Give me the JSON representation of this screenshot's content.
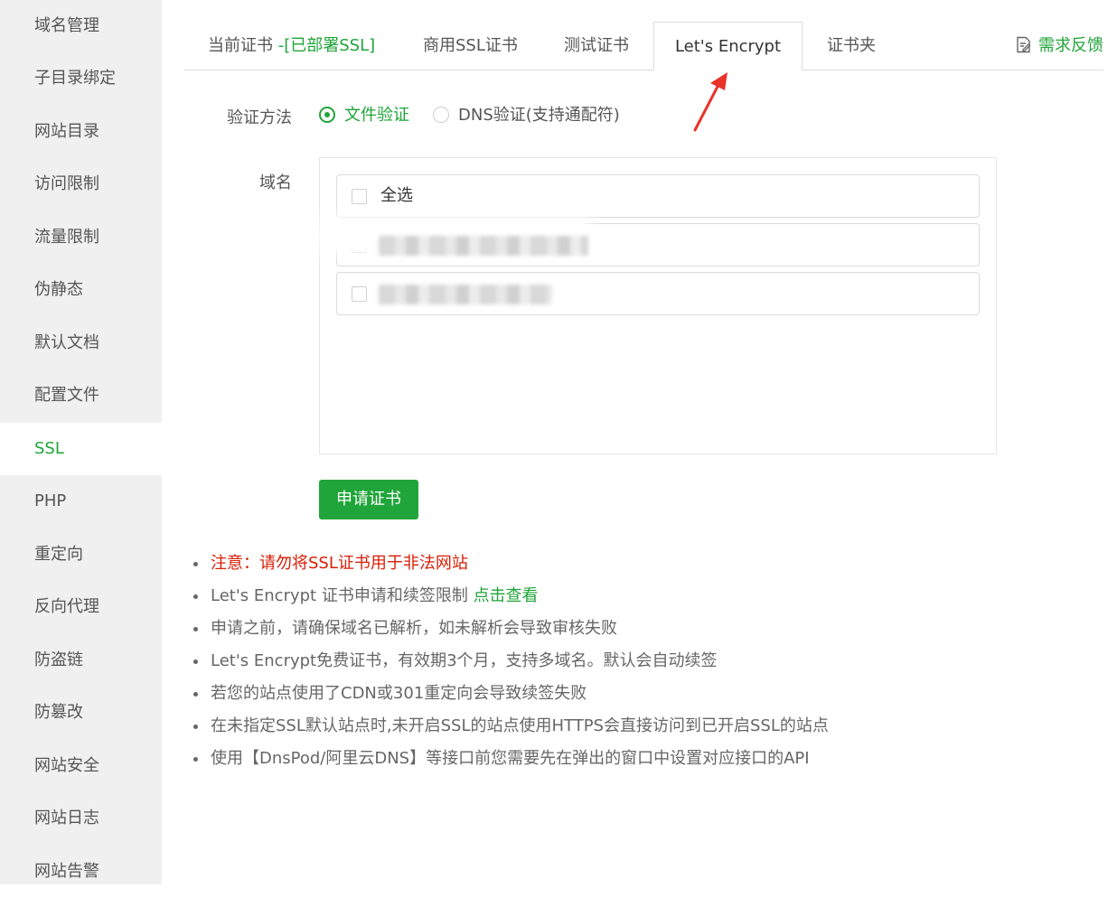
{
  "sidebar": {
    "items": [
      {
        "label": "域名管理"
      },
      {
        "label": "子目录绑定"
      },
      {
        "label": "网站目录"
      },
      {
        "label": "访问限制"
      },
      {
        "label": "流量限制"
      },
      {
        "label": "伪静态"
      },
      {
        "label": "默认文档"
      },
      {
        "label": "配置文件"
      },
      {
        "label": "SSL",
        "active": true
      },
      {
        "label": "PHP"
      },
      {
        "label": "重定向"
      },
      {
        "label": "反向代理"
      },
      {
        "label": "防盗链"
      },
      {
        "label": "防篡改"
      },
      {
        "label": "网站安全"
      },
      {
        "label": "网站日志"
      },
      {
        "label": "网站告警"
      }
    ]
  },
  "tabs": {
    "current_cert": "当前证书",
    "current_status": "-[已部署SSL]",
    "commercial": "商用SSL证书",
    "test": "测试证书",
    "letsencrypt": "Let's Encrypt",
    "cert_folder": "证书夹",
    "active": "letsencrypt"
  },
  "feedback": {
    "label": "需求反馈",
    "icon": "edit-note-icon"
  },
  "verify": {
    "label": "验证方法",
    "options": [
      {
        "label": "文件验证",
        "checked": true
      },
      {
        "label": "DNS验证(支持通配符)",
        "checked": false
      }
    ]
  },
  "domain": {
    "label": "域名",
    "select_all": "全选"
  },
  "apply_button": "申请证书",
  "tips": {
    "notice": "注意：请勿将SSL证书用于非法网站",
    "limit_prefix": "Let's Encrypt 证书申请和续签限制 ",
    "limit_link": "点击查看",
    "resolve": "申请之前，请确保域名已解析，如未解析会导致审核失败",
    "free": "Let's Encrypt免费证书，有效期3个月，支持多域名。默认会自动续签",
    "cdn": "若您的站点使用了CDN或301重定向会导致续签失败",
    "default_site": "在未指定SSL默认站点时,未开启SSL的站点使用HTTPS会直接访问到已开启SSL的站点",
    "dnsapi": "使用【DnsPod/阿里云DNS】等接口前您需要先在弹出的窗口中设置对应接口的API"
  },
  "colors": {
    "accent": "#20a53a",
    "danger": "#d81e06",
    "annotation_arrow": "#e8322a",
    "sidebar_bg": "#f0f0f0"
  }
}
